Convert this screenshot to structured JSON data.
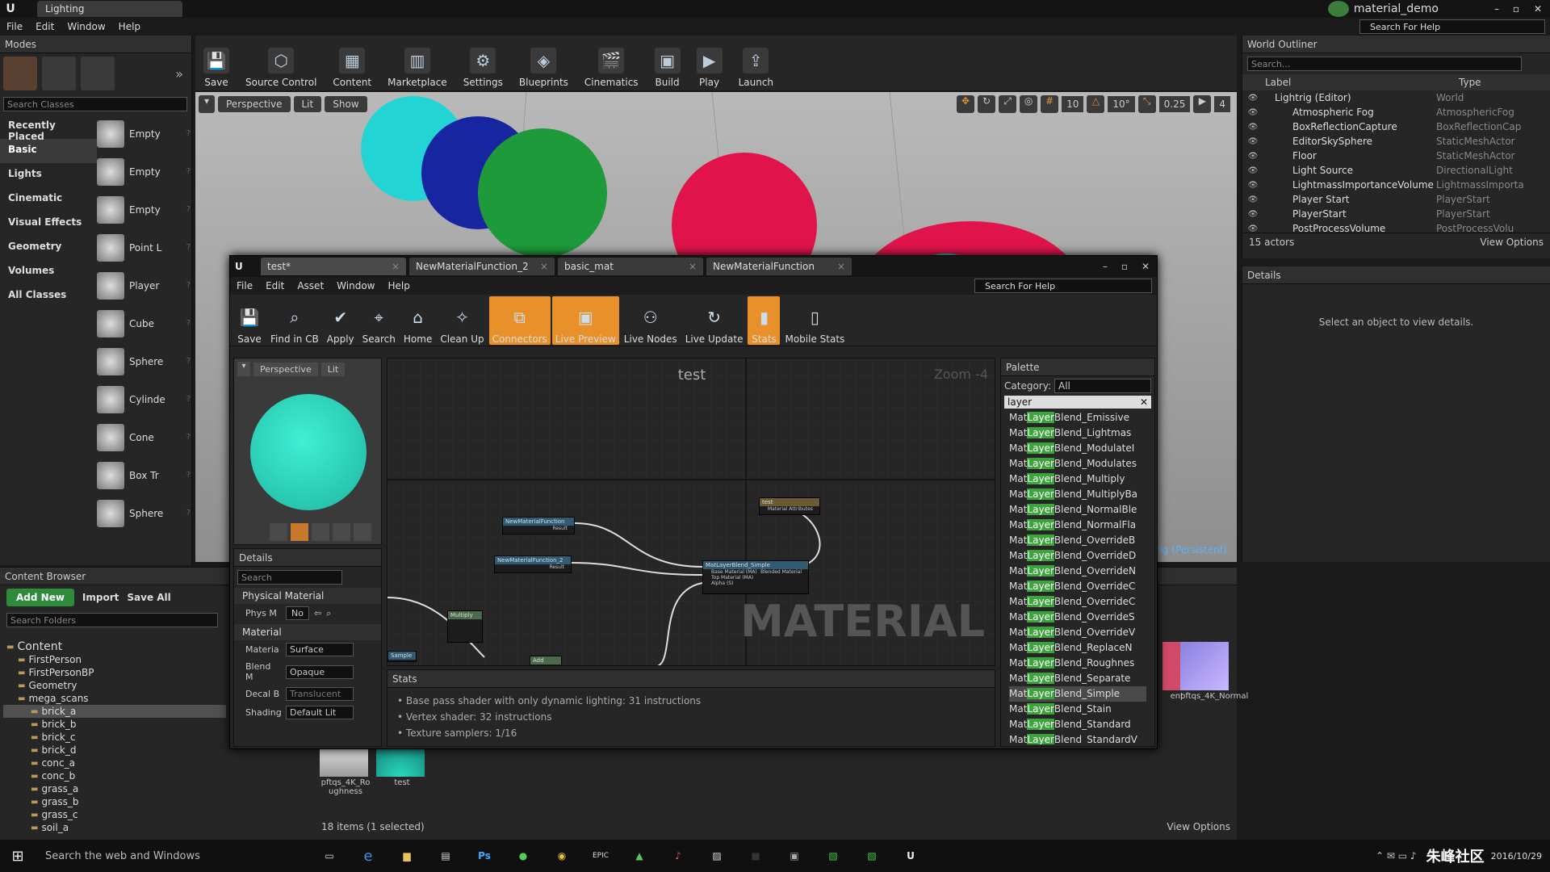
{
  "app": {
    "tab_title": "Lighting",
    "project": "material_demo",
    "search_help": "Search For Help"
  },
  "main_menu": [
    "File",
    "Edit",
    "Window",
    "Help"
  ],
  "modes": {
    "title": "Modes",
    "search_placeholder": "Search Classes",
    "categories": [
      "Recently Placed",
      "Basic",
      "Lights",
      "Cinematic",
      "Visual Effects",
      "Geometry",
      "Volumes",
      "All Classes"
    ],
    "items": [
      "Empty",
      "Empty",
      "Empty",
      "Point L",
      "Player",
      "Cube",
      "Sphere",
      "Cylinde",
      "Cone",
      "Box Tr",
      "Sphere"
    ]
  },
  "toolbar": [
    {
      "label": "Save",
      "icon": "save-icon"
    },
    {
      "label": "Source Control",
      "icon": "source-control-icon"
    },
    {
      "label": "Content",
      "icon": "content-icon"
    },
    {
      "label": "Marketplace",
      "icon": "marketplace-icon"
    },
    {
      "label": "Settings",
      "icon": "settings-icon"
    },
    {
      "label": "Blueprints",
      "icon": "blueprints-icon"
    },
    {
      "label": "Cinematics",
      "icon": "cinematics-icon"
    },
    {
      "label": "Build",
      "icon": "build-icon"
    },
    {
      "label": "Play",
      "icon": "play-icon"
    },
    {
      "label": "Launch",
      "icon": "launch-icon"
    }
  ],
  "viewport": {
    "perspective": "Perspective",
    "lit": "Lit",
    "show": "Show",
    "grid": "10",
    "angle": "10°",
    "scale": "0.25",
    "cam": "4",
    "level": "trig (Persistent)"
  },
  "outliner": {
    "title": "World Outliner",
    "search_placeholder": "Search...",
    "col_label": "Label",
    "col_type": "Type",
    "rows": [
      {
        "label": "Lightrig (Editor)",
        "type": "World"
      },
      {
        "label": "Atmospheric Fog",
        "type": "AtmosphericFog"
      },
      {
        "label": "BoxReflectionCapture",
        "type": "BoxReflectionCap"
      },
      {
        "label": "EditorSkySphere",
        "type": "StaticMeshActor"
      },
      {
        "label": "Floor",
        "type": "StaticMeshActor"
      },
      {
        "label": "Light Source",
        "type": "DirectionalLight"
      },
      {
        "label": "LightmassImportanceVolume",
        "type": "LightmassImporta"
      },
      {
        "label": "Player Start",
        "type": "PlayerStart"
      },
      {
        "label": "PlayerStart",
        "type": "PlayerStart"
      },
      {
        "label": "PostProcessVolume",
        "type": "PostProcessVolu"
      }
    ],
    "count": "15 actors",
    "view_options": "View Options"
  },
  "details_right": {
    "title": "Details",
    "empty": "Select an object to view details."
  },
  "content_browser": {
    "title": "Content Browser",
    "add_new": "Add New",
    "import": "Import",
    "save_all": "Save All",
    "search_folders": "Search Folders",
    "tree": [
      "Content",
      "FirstPerson",
      "FirstPersonBP",
      "Geometry",
      "mega_scans",
      "brick_a",
      "brick_b",
      "brick_c",
      "brick_d",
      "conc_a",
      "conc_b",
      "grass_a",
      "grass_b",
      "grass_c",
      "soil_a"
    ],
    "assets": [
      {
        "name": "pftqs_4K_Roughness"
      },
      {
        "name": "test"
      }
    ],
    "right_assets": [
      {
        "name": "ent"
      },
      {
        "name": "pftqs_4K_Normal"
      }
    ],
    "status": "18 items (1 selected)",
    "view_options": "View Options"
  },
  "material_editor": {
    "tabs": [
      "test*",
      "NewMaterialFunction_2",
      "basic_mat",
      "NewMaterialFunction"
    ],
    "menu": [
      "File",
      "Edit",
      "Asset",
      "Window",
      "Help"
    ],
    "search_help": "Search For Help",
    "toolbar": [
      {
        "label": "Save",
        "active": false
      },
      {
        "label": "Find in CB",
        "active": false
      },
      {
        "label": "Apply",
        "active": false
      },
      {
        "label": "Search",
        "active": false
      },
      {
        "label": "Home",
        "active": false
      },
      {
        "label": "Clean Up",
        "active": false
      },
      {
        "label": "Connectors",
        "active": true
      },
      {
        "label": "Live Preview",
        "active": true
      },
      {
        "label": "Live Nodes",
        "active": false
      },
      {
        "label": "Live Update",
        "active": false
      },
      {
        "label": "Stats",
        "active": true
      },
      {
        "label": "Mobile Stats",
        "active": false
      }
    ],
    "preview": {
      "perspective": "Perspective",
      "lit": "Lit"
    },
    "graph": {
      "title": "test",
      "zoom": "Zoom -4",
      "watermark": "MATERIAL",
      "nodes": [
        {
          "title": "NewMaterialFunction",
          "pin": "Result"
        },
        {
          "title": "NewMaterialFunction_2",
          "pin": "Result"
        },
        {
          "title": "MatLayerBlend_Simple",
          "pins": [
            "Base Material (MA)",
            "Top Material (MA)",
            "Alpha (S)"
          ],
          "out": "Blended Material"
        },
        {
          "title": "test",
          "pin": "Material Attributes"
        },
        {
          "title": "Multiply"
        },
        {
          "title": "Add"
        },
        {
          "title": "Sample"
        }
      ]
    },
    "details": {
      "title": "Details",
      "search_placeholder": "Search",
      "section_physical": "Physical Material",
      "phys_label": "Phys M",
      "phys_value": "No",
      "section_material": "Material",
      "rows": [
        {
          "label": "Materia",
          "value": "Surface"
        },
        {
          "label": "Blend M",
          "value": "Opaque"
        },
        {
          "label": "Decal B",
          "value": "Translucent"
        },
        {
          "label": "Shading",
          "value": "Default Lit"
        }
      ]
    },
    "stats": {
      "title": "Stats",
      "lines": [
        "Base pass shader with only dynamic lighting: 31 instructions",
        "Vertex shader: 32 instructions",
        "Texture samplers: 1/16"
      ]
    },
    "palette": {
      "title": "Palette",
      "category_label": "Category:",
      "category_value": "All",
      "search_value": "layer",
      "items": [
        {
          "pre": "Mat",
          "hl": "Layer",
          "post": "Blend_Emissive"
        },
        {
          "pre": "Mat",
          "hl": "Layer",
          "post": "Blend_Lightmas"
        },
        {
          "pre": "Mat",
          "hl": "Layer",
          "post": "Blend_ModulateI"
        },
        {
          "pre": "Mat",
          "hl": "Layer",
          "post": "Blend_Modulates"
        },
        {
          "pre": "Mat",
          "hl": "Layer",
          "post": "Blend_Multiply"
        },
        {
          "pre": "Mat",
          "hl": "Layer",
          "post": "Blend_MultiplyBa"
        },
        {
          "pre": "Mat",
          "hl": "Layer",
          "post": "Blend_NormalBle"
        },
        {
          "pre": "Mat",
          "hl": "Layer",
          "post": "Blend_NormalFla"
        },
        {
          "pre": "Mat",
          "hl": "Layer",
          "post": "Blend_OverrideB"
        },
        {
          "pre": "Mat",
          "hl": "Layer",
          "post": "Blend_OverrideD"
        },
        {
          "pre": "Mat",
          "hl": "Layer",
          "post": "Blend_OverrideN"
        },
        {
          "pre": "Mat",
          "hl": "Layer",
          "post": "Blend_OverrideC"
        },
        {
          "pre": "Mat",
          "hl": "Layer",
          "post": "Blend_OverrideC"
        },
        {
          "pre": "Mat",
          "hl": "Layer",
          "post": "Blend_OverrideS"
        },
        {
          "pre": "Mat",
          "hl": "Layer",
          "post": "Blend_OverrideV"
        },
        {
          "pre": "Mat",
          "hl": "Layer",
          "post": "Blend_ReplaceN"
        },
        {
          "pre": "Mat",
          "hl": "Layer",
          "post": "Blend_Roughnes"
        },
        {
          "pre": "Mat",
          "hl": "Layer",
          "post": "Blend_Separate"
        },
        {
          "pre": "Mat",
          "hl": "Layer",
          "post": "Blend_Simple"
        },
        {
          "pre": "Mat",
          "hl": "Layer",
          "post": "Blend_Stain"
        },
        {
          "pre": "Mat",
          "hl": "Layer",
          "post": "Blend_Standard"
        },
        {
          "pre": "Mat",
          "hl": "Layer",
          "post": "Blend_StandardV"
        }
      ],
      "selected_index": 18
    }
  },
  "taskbar": {
    "search": "Search the web and Windows",
    "clock": "2016/10/29",
    "watermark": "朱峰社区"
  },
  "colors": {
    "accent_orange": "#e8912b",
    "highlight_green": "#3da43d",
    "teal": "#27d9be",
    "ue_bg": "#242424"
  }
}
